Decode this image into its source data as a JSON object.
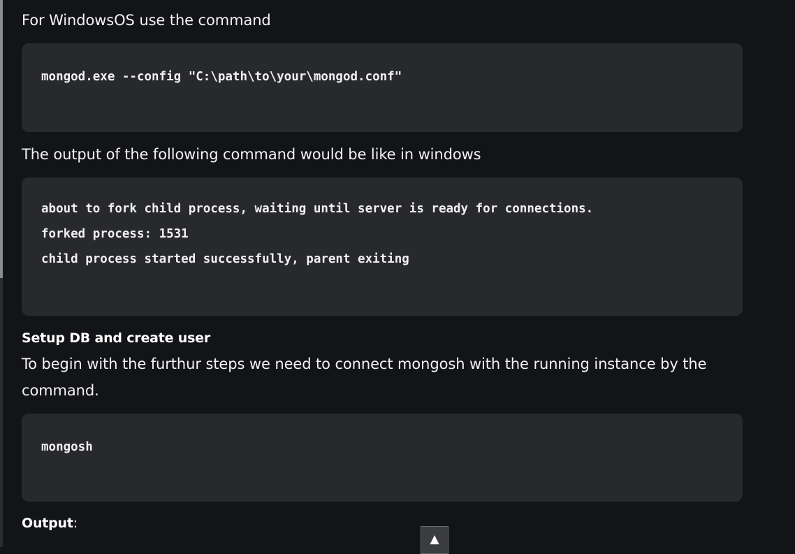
{
  "paragraphs": {
    "windows_intro": "For WindowsOS use the command",
    "output_intro": "The output of the following command would be like in windows",
    "connect_intro": "To begin with the furthur steps we need to connect mongosh with the running instance by the command."
  },
  "headings": {
    "setup": "Setup DB and create user",
    "output_bold": "Output",
    "output_colon": ":"
  },
  "code_blocks": {
    "windows_command": [
      "mongod.exe --config \"C:\\path\\to\\your\\mongod.conf\""
    ],
    "fork_output": [
      "about to fork child process, waiting until server is ready for connections.",
      "forked process: 1531",
      "child process started successfully, parent exiting"
    ],
    "mongosh_command": [
      "mongosh"
    ]
  },
  "scroll_top_button": {
    "icon": "triangle-up-icon",
    "glyph": "▲"
  }
}
